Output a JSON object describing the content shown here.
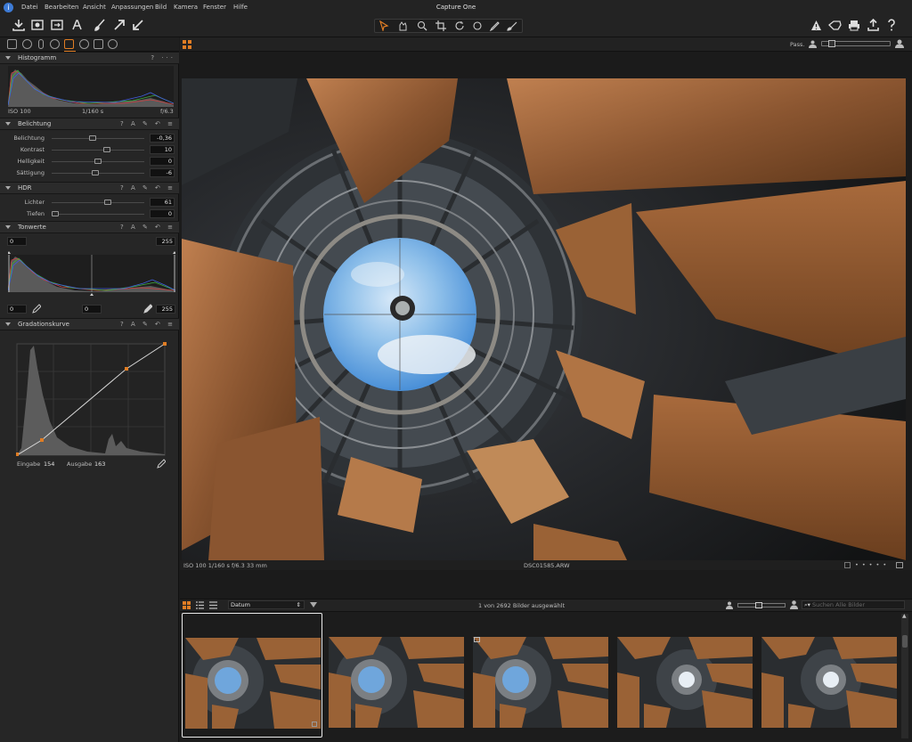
{
  "app": {
    "title": "Capture One"
  },
  "menu": [
    "Datei",
    "Bearbeiten",
    "Ansicht",
    "Anpassungen",
    "Bild",
    "Kamera",
    "Fenster",
    "Hilfe"
  ],
  "viewer": {
    "pass_label": "Pass.",
    "info_left": "ISO 100  1/160 s  f/6.3  33 mm",
    "filename": "DSC01585.ARW"
  },
  "histogram": {
    "title": "Histogramm",
    "iso": "ISO 100",
    "shutter": "1/160 s",
    "aperture": "f/6.3",
    "actions": "? ···"
  },
  "exposure": {
    "title": "Belichtung",
    "actions": "? A ✎ ↶ ≡",
    "rows": [
      {
        "label": "Belichtung",
        "value": "-0,36",
        "pos": 0.44
      },
      {
        "label": "Kontrast",
        "value": "10",
        "pos": 0.6
      },
      {
        "label": "Helligkeit",
        "value": "0",
        "pos": 0.5
      },
      {
        "label": "Sättigung",
        "value": "-6",
        "pos": 0.47
      }
    ]
  },
  "hdr": {
    "title": "HDR",
    "actions": "? A ✎ ↶ ≡",
    "rows": [
      {
        "label": "Lichter",
        "value": "61",
        "pos": 0.61
      },
      {
        "label": "Tiefen",
        "value": "0",
        "pos": 0.0
      }
    ]
  },
  "levels": {
    "title": "Tonwerte",
    "actions": "? A ✎ ↶ ≡",
    "input_min": "0",
    "input_max": "255",
    "output_min": "0",
    "output_mid": "0",
    "output_max": "255"
  },
  "curve": {
    "title": "Gradationskurve",
    "actions": "? A ✎ ↶ ≡",
    "input_label": "Eingabe",
    "input_value": "154",
    "output_label": "Ausgabe",
    "output_value": "163"
  },
  "browser": {
    "sort": "Datum",
    "count_text": "1 von 2692 Bilder ausgewählt",
    "search_placeholder": "Suchen Alle Bilder"
  },
  "icons": {
    "toolbar_left": [
      "import-icon",
      "capture-icon",
      "export-icon",
      "text-icon",
      "brush-icon",
      "arrow-up-right-icon",
      "arrow-down-left-icon"
    ],
    "cursor_tools": [
      "select-cursor-icon",
      "pan-icon",
      "zoom-icon",
      "crop-icon",
      "rotate-icon",
      "spot-icon",
      "picker-icon",
      "mask-icon"
    ],
    "toolbar_right": [
      "warning-icon",
      "tag-icon",
      "print-icon",
      "share-icon",
      "help-icon"
    ]
  },
  "colors": {
    "accent": "#e07d24",
    "selection": "#e8e8e8"
  }
}
